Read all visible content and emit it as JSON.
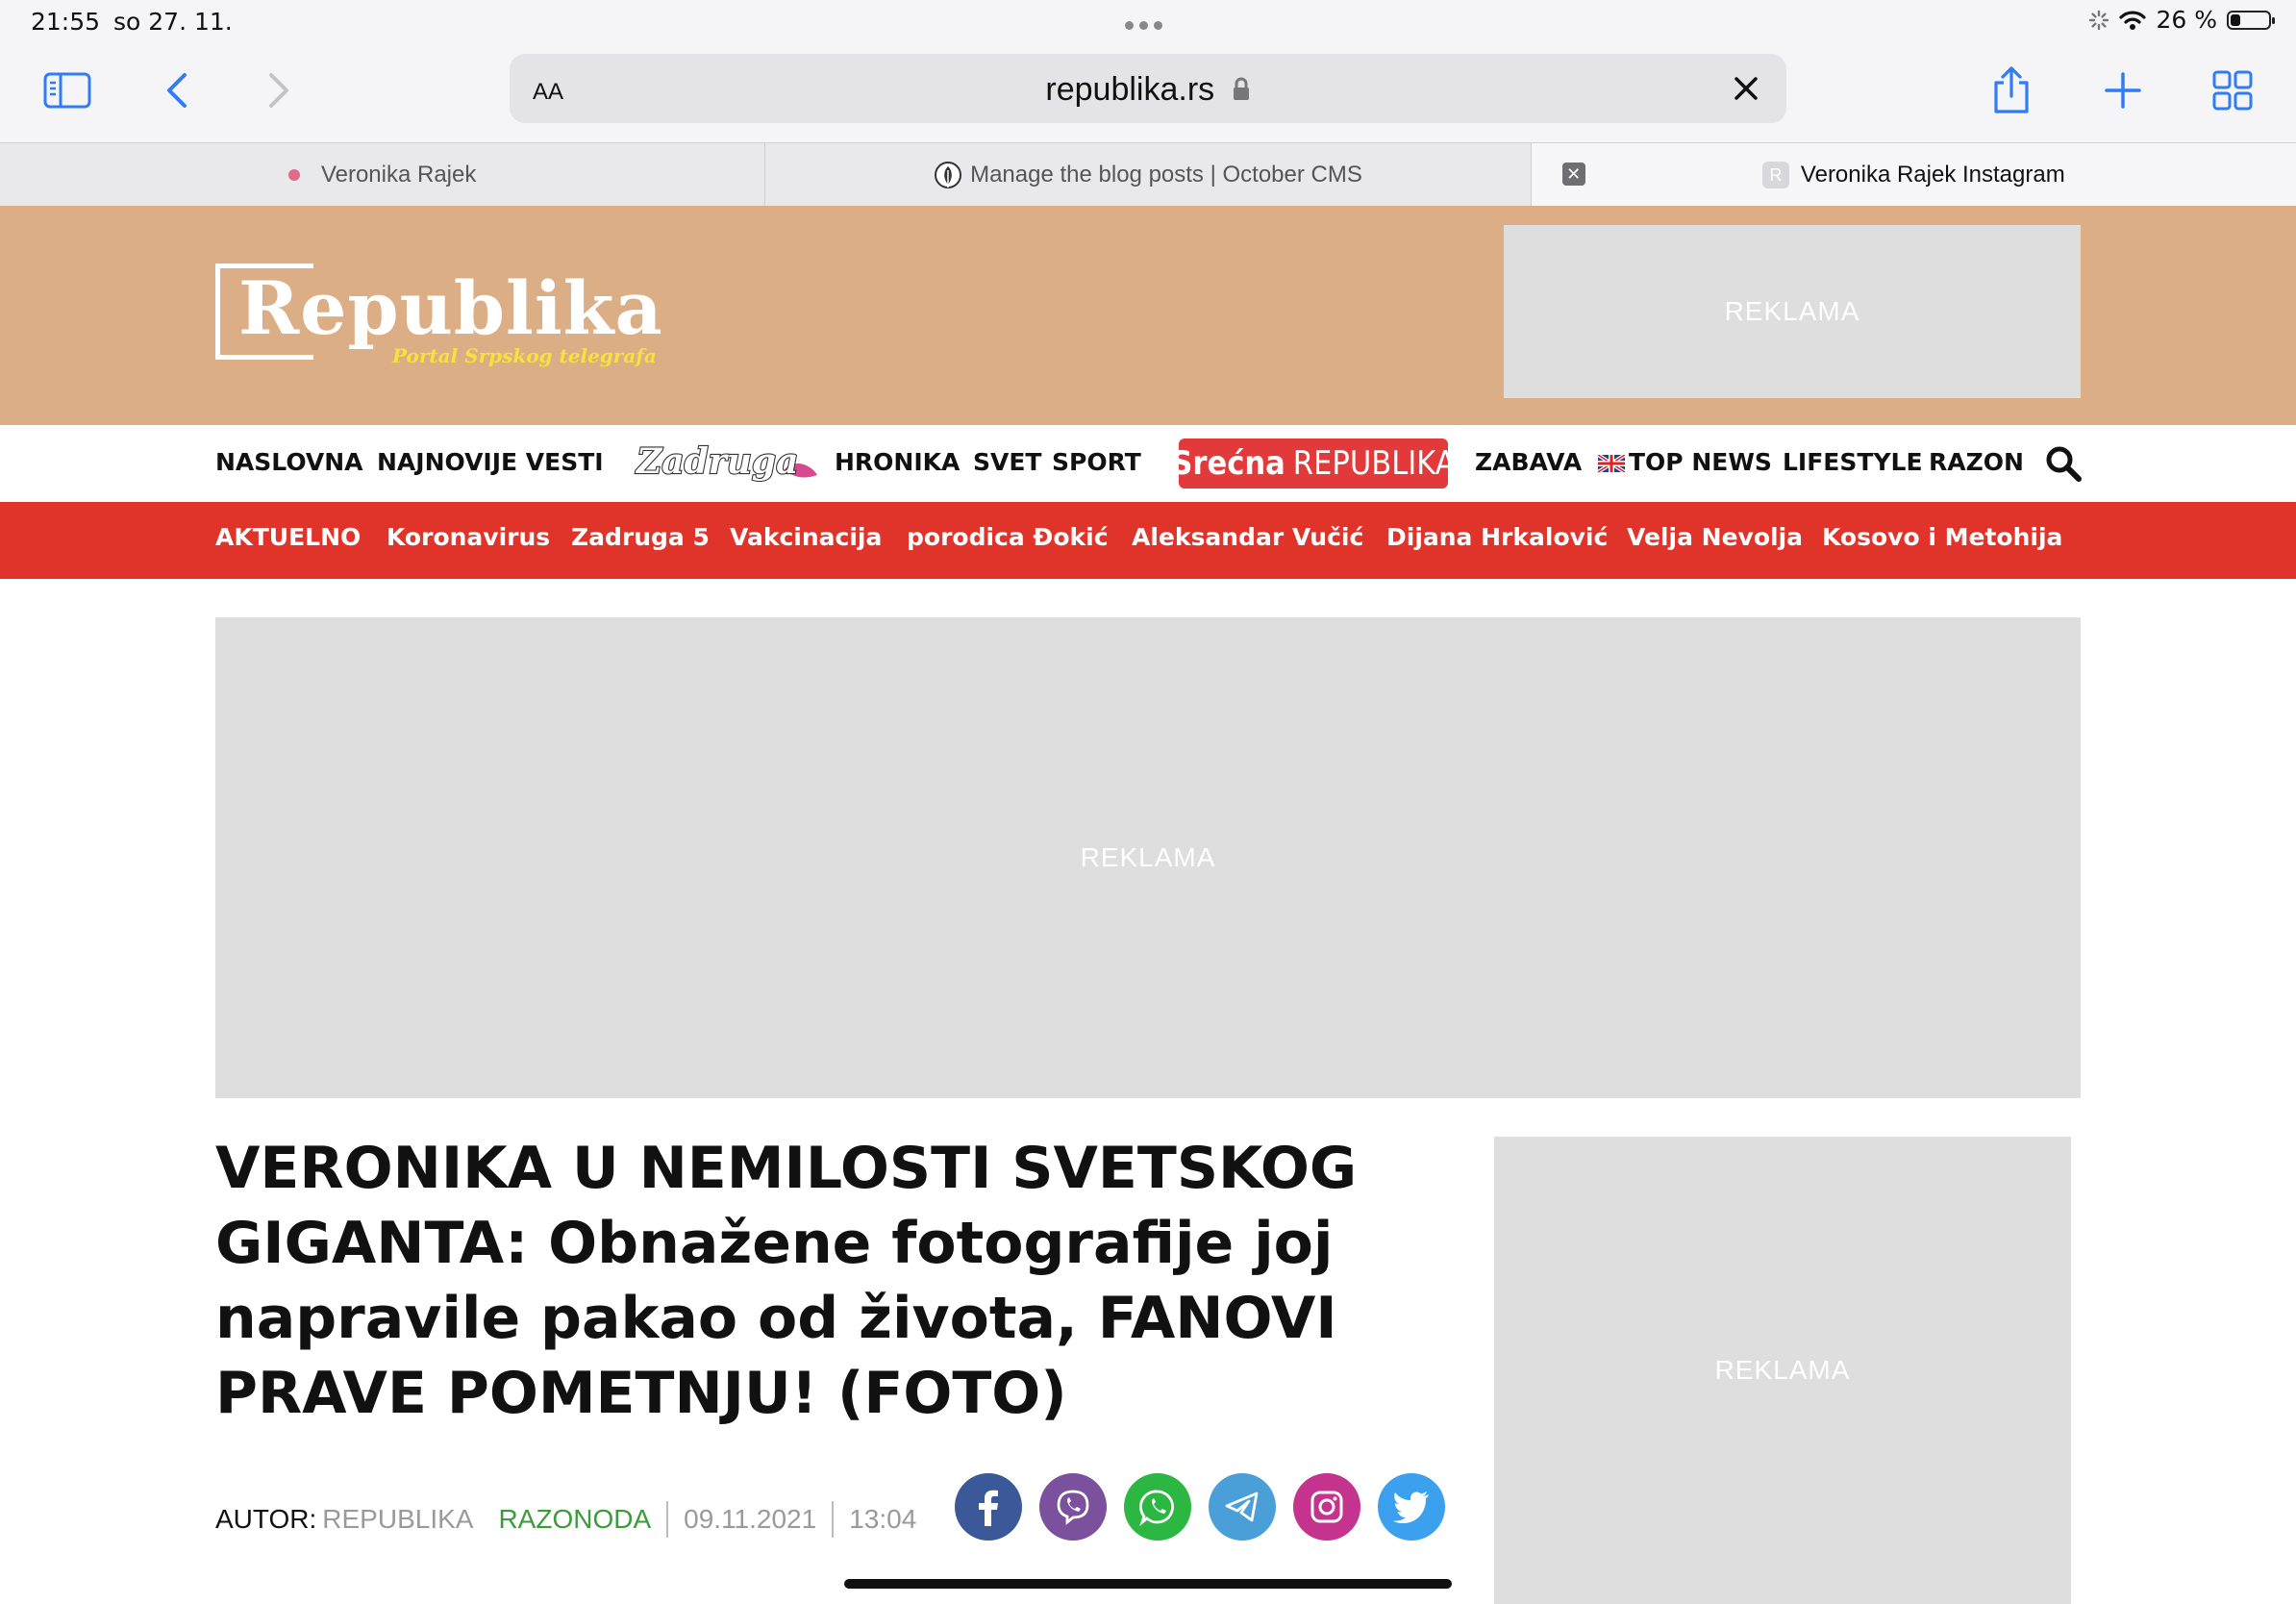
{
  "status": {
    "time": "21:55",
    "date": "so 27. 11.",
    "battery": "26 %",
    "battery_level": 0.26
  },
  "browser": {
    "aa_label": "AA",
    "url": "republika.rs",
    "tabs": [
      {
        "title": "Veronika Rajek"
      },
      {
        "title": "Manage the blog posts | October CMS"
      },
      {
        "title": "Veronika Rajek Instagram",
        "favicon_letter": "R"
      }
    ]
  },
  "site": {
    "logo_word": "Republika",
    "logo_sub": "Portal Srpskog telegrafa",
    "ad_label": "REKLAMA",
    "nav": {
      "naslovna": "NASLOVNA",
      "najnovije": "NAJNOVIJE VESTI",
      "zadruga": "Zadruga",
      "hronika": "HRONIKA",
      "svet": "SVET",
      "sport": "SPORT",
      "srecna_a": "Srećna",
      "srecna_b": "REPUBLIKA",
      "zabava": "ZABAVA",
      "topnews": "TOP NEWS",
      "lifestyle": "LIFESTYLE",
      "razon": "RAZON"
    },
    "topics": [
      "AKTUELNO",
      "Koronavirus",
      "Zadruga 5",
      "Vakcinacija",
      "porodica Đokić",
      "Aleksandar Vučić",
      "Dijana Hrkalović",
      "Velja Nevolja",
      "Kosovo i Metohija"
    ]
  },
  "article": {
    "headline": "VERONIKA U NEMILOSTI SVETSKOG GIGANTA: Obnažene fotografije joj napravile pakao od života, FANOVI PRAVE POMETNJU! (FOTO)",
    "author_label": "AUTOR:",
    "author": "REPUBLIKA",
    "category": "RAZONODA",
    "date": "09.11.2021",
    "time": "13:04"
  },
  "share_icons": [
    "facebook-icon",
    "viber-icon",
    "whatsapp-icon",
    "telegram-icon",
    "instagram-icon",
    "twitter-icon"
  ],
  "colors": {
    "header_bg": "#dcae86",
    "red_nav": "#e0332a",
    "facebook": "#3b5998",
    "viber": "#7b519d",
    "whatsapp": "#2cb742",
    "telegram": "#4a9fd8",
    "instagram": "#c4348f",
    "twitter": "#3ba0ee",
    "category_green": "#3d9a3d"
  }
}
